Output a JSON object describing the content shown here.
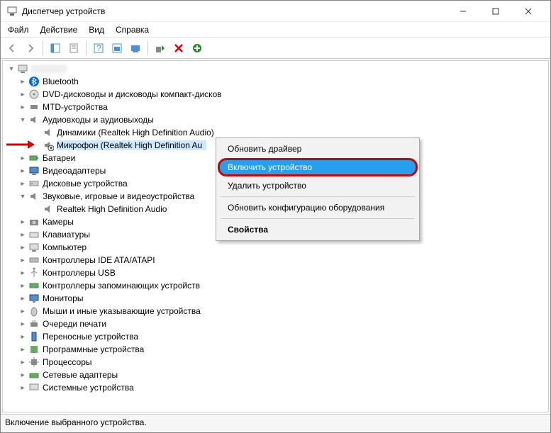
{
  "window": {
    "title": "Диспетчер устройств"
  },
  "menu": {
    "file": "Файл",
    "action": "Действие",
    "view": "Вид",
    "help": "Справка"
  },
  "root": "",
  "nodes": {
    "bluetooth": "Bluetooth",
    "dvd": "DVD-дисководы и дисководы компакт-дисков",
    "mtd": "MTD-устройства",
    "audio": "Аудиовходы и аудиовыходы",
    "speakers": "Динамики (Realtek High Definition Audio)",
    "mic": "Микрофон (Realtek High Definition Au",
    "battery": "Батареи",
    "video": "Видеоадаптеры",
    "disk": "Дисковые устройства",
    "sound": "Звуковые, игровые и видеоустройства",
    "realtek": "Realtek High Definition Audio",
    "camera": "Камеры",
    "keyboard": "Клавиатуры",
    "computer": "Компьютер",
    "ide": "Контроллеры IDE ATA/ATAPI",
    "usb": "Контроллеры USB",
    "storage": "Контроллеры запоминающих устройств",
    "monitor": "Мониторы",
    "mouse": "Мыши и иные указывающие устройства",
    "printq": "Очереди печати",
    "portable": "Переносные устройства",
    "software": "Программные устройства",
    "cpu": "Процессоры",
    "net": "Сетевые адаптеры",
    "sys": "Системные устройства"
  },
  "context_menu": {
    "update_driver": "Обновить драйвер",
    "enable_device": "Включить устройство",
    "remove_device": "Удалить устройство",
    "scan_hardware": "Обновить конфигурацию оборудования",
    "properties": "Свойства"
  },
  "status": "Включение выбранного устройства."
}
